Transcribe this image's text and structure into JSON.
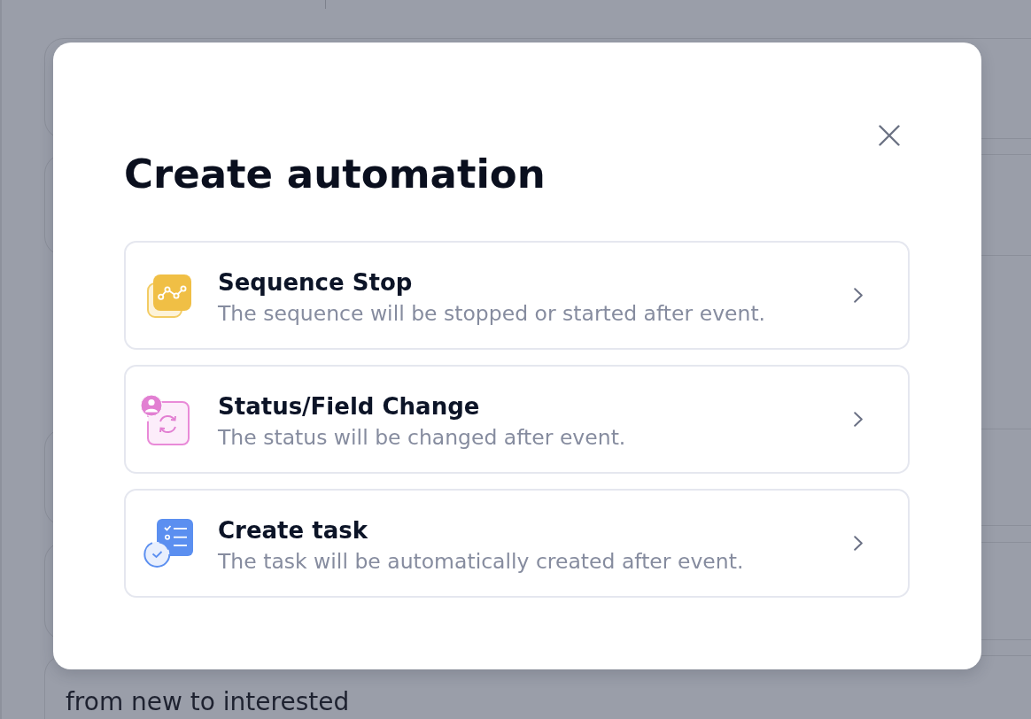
{
  "page": {
    "field_value": "from new to interested"
  },
  "dialog": {
    "title": "Create automation",
    "options": [
      {
        "kind": "sequence",
        "title": "Sequence Stop",
        "description": "The sequence will be stopped or started after event."
      },
      {
        "kind": "status",
        "title": "Status/Field Change",
        "description": "The status will be changed after event."
      },
      {
        "kind": "task",
        "title": "Create task",
        "description": "The task will be automatically created after event."
      }
    ]
  }
}
